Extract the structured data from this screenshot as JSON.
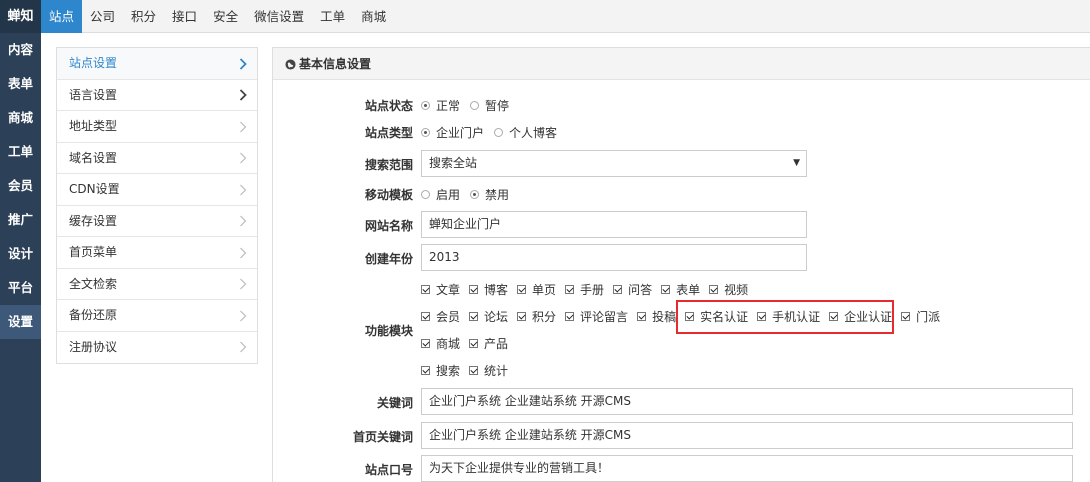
{
  "leftbar": {
    "brand": "蝉知",
    "items": [
      "内容",
      "表单",
      "商城",
      "工单",
      "会员",
      "推广",
      "设计",
      "平台",
      "设置"
    ],
    "active_index": 8
  },
  "topbar": {
    "tabs": [
      "站点",
      "公司",
      "积分",
      "接口",
      "安全",
      "微信设置",
      "工单",
      "商城"
    ],
    "active_index": 0
  },
  "submenu": {
    "items": [
      "站点设置",
      "语言设置",
      "地址类型",
      "域名设置",
      "CDN设置",
      "缓存设置",
      "首页菜单",
      "全文检索",
      "备份还原",
      "注册协议"
    ],
    "active_index": 0
  },
  "panel": {
    "title": "基本信息设置",
    "site_status": {
      "label": "站点状态",
      "options": [
        "正常",
        "暂停"
      ],
      "selected": 0
    },
    "site_type": {
      "label": "站点类型",
      "options": [
        "企业门户",
        "个人博客"
      ],
      "selected": 0
    },
    "search_scope": {
      "label": "搜索范围",
      "value": "搜索全站",
      "arrow": "▼"
    },
    "mobile_template": {
      "label": "移动模板",
      "options": [
        "启用",
        "禁用"
      ],
      "selected": 1
    },
    "site_name": {
      "label": "网站名称",
      "value": "蝉知企业门户"
    },
    "founded_year": {
      "label": "创建年份",
      "value": "2013"
    },
    "modules": {
      "label": "功能模块",
      "line1": [
        "文章",
        "博客",
        "单页",
        "手册",
        "问答",
        "表单",
        "视频"
      ],
      "line2": [
        "会员",
        "论坛",
        "积分",
        "评论留言",
        "投稿",
        "实名认证",
        "手机认证",
        "企业认证",
        "门派"
      ],
      "line3": [
        "商城",
        "产品"
      ],
      "line4": [
        "搜索",
        "统计"
      ]
    },
    "keywords": {
      "label": "关键词",
      "value": "企业门户系统 企业建站系统 开源CMS"
    },
    "home_keywords": {
      "label": "首页关键词",
      "value": "企业门户系统 企业建站系统 开源CMS"
    },
    "slogan": {
      "label": "站点口号",
      "value": "为天下企业提供专业的营销工具！"
    }
  },
  "colors": {
    "sidebar": "#2c4058",
    "accent": "#2e86cc",
    "highlight": "#e52b2b"
  }
}
